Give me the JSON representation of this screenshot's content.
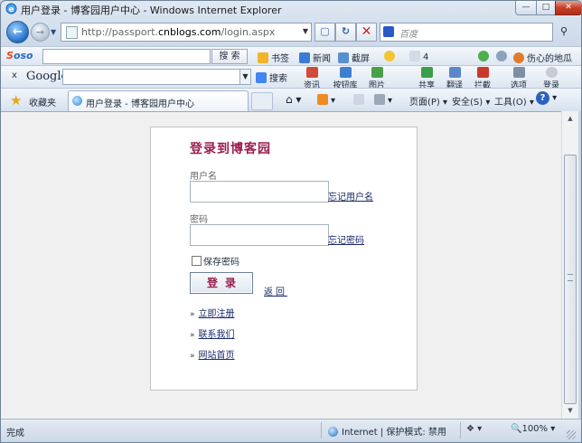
{
  "window": {
    "title": "用户登录 - 博客园用户中心 - Windows Internet Explorer",
    "minimize": "—",
    "maximize": "□",
    "close": "✕"
  },
  "address": {
    "url_prefix": "http://passport.",
    "url_domain": "cnblogs.com",
    "url_path": "/login.aspx",
    "search_placeholder": "百度"
  },
  "soso_bar": {
    "logo_a": "S",
    "logo_b": "oso",
    "search_button": "搜 索",
    "items": [
      "书签",
      "新闻",
      "截屏",
      "4",
      "伤心的地瓜"
    ]
  },
  "google_bar": {
    "close": "x",
    "logo": "Google",
    "items": [
      "搜索",
      "资讯",
      "按钮库",
      "图片",
      "共享",
      "翻译",
      "拦截",
      "选项",
      "登录"
    ]
  },
  "command_bar": {
    "favorites": "收藏夹",
    "tab_title": "用户登录 - 博客园用户中心",
    "page_menu": "页面(P)",
    "safety_menu": "安全(S)",
    "tools_menu": "工具(O)",
    "help": "?"
  },
  "login": {
    "title": "登录到博客园",
    "username_label": "用户名",
    "username_value": "",
    "forgot_username": "忘记用户名",
    "password_label": "密码",
    "password_value": "",
    "forgot_password": "忘记密码",
    "remember_label": "保存密码",
    "remember_checked": false,
    "login_button": "登录",
    "back_link": "返回",
    "links": [
      "立即注册",
      "联系我们",
      "网站首页"
    ],
    "link_marker": "»"
  },
  "status": {
    "text": "完成",
    "zone": "Internet | 保护模式: 禁用",
    "zoom": "100%"
  },
  "colors": {
    "accent": "#9c1c4e",
    "link": "#1a2a6a"
  }
}
